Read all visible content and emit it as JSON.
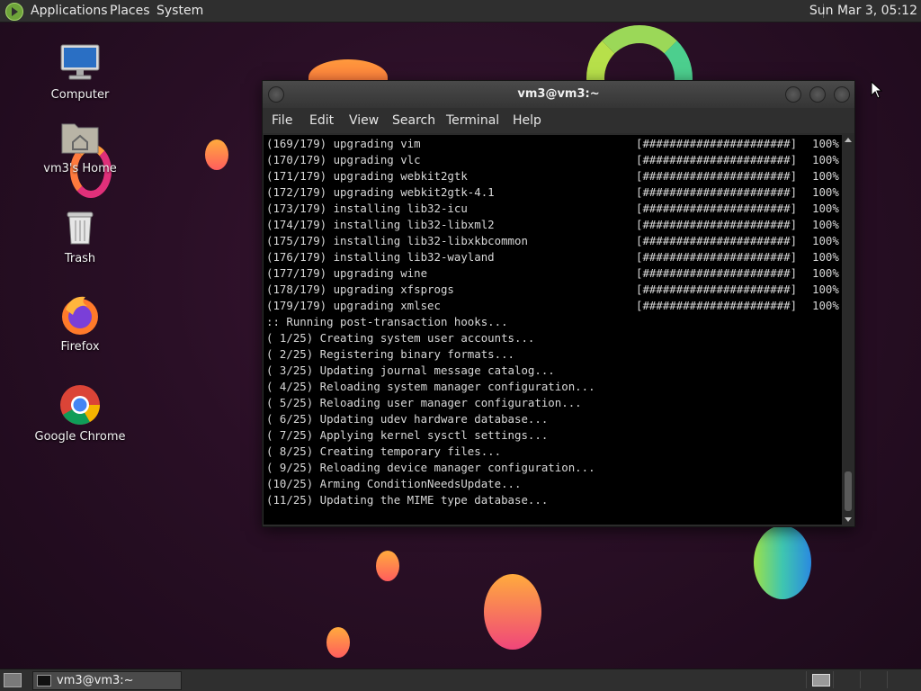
{
  "top_panel": {
    "menus": [
      "Applications",
      "Places",
      "System"
    ],
    "clock": "Sun Mar  3, 05:12"
  },
  "desktop": {
    "icons": [
      {
        "label": "Computer",
        "icon": "computer-icon"
      },
      {
        "label": "vm3's Home",
        "icon": "home-folder-icon"
      },
      {
        "label": "Trash",
        "icon": "trash-icon"
      },
      {
        "label": "Firefox",
        "icon": "firefox-icon"
      },
      {
        "label": "Google Chrome",
        "icon": "chrome-icon"
      }
    ]
  },
  "terminal": {
    "title": "vm3@vm3:~",
    "menu": [
      "File",
      "Edit",
      "View",
      "Search",
      "Terminal",
      "Help"
    ],
    "progress_lines": [
      {
        "text": "(169/179) upgrading vim",
        "bar": "[######################]",
        "pct": "100%"
      },
      {
        "text": "(170/179) upgrading vlc",
        "bar": "[######################]",
        "pct": "100%"
      },
      {
        "text": "(171/179) upgrading webkit2gtk",
        "bar": "[######################]",
        "pct": "100%"
      },
      {
        "text": "(172/179) upgrading webkit2gtk-4.1",
        "bar": "[######################]",
        "pct": "100%"
      },
      {
        "text": "(173/179) installing lib32-icu",
        "bar": "[######################]",
        "pct": "100%"
      },
      {
        "text": "(174/179) installing lib32-libxml2",
        "bar": "[######################]",
        "pct": "100%"
      },
      {
        "text": "(175/179) installing lib32-libxkbcommon",
        "bar": "[######################]",
        "pct": "100%"
      },
      {
        "text": "(176/179) installing lib32-wayland",
        "bar": "[######################]",
        "pct": "100%"
      },
      {
        "text": "(177/179) upgrading wine",
        "bar": "[######################]",
        "pct": "100%"
      },
      {
        "text": "(178/179) upgrading xfsprogs",
        "bar": "[######################]",
        "pct": "100%"
      },
      {
        "text": "(179/179) upgrading xmlsec",
        "bar": "[######################]",
        "pct": "100%"
      }
    ],
    "hook_lines": [
      ":: Running post-transaction hooks...",
      "( 1/25) Creating system user accounts...",
      "( 2/25) Registering binary formats...",
      "( 3/25) Updating journal message catalog...",
      "( 4/25) Reloading system manager configuration...",
      "( 5/25) Reloading user manager configuration...",
      "( 6/25) Updating udev hardware database...",
      "( 7/25) Applying kernel sysctl settings...",
      "( 8/25) Creating temporary files...",
      "( 9/25) Reloading device manager configuration...",
      "(10/25) Arming ConditionNeedsUpdate...",
      "(11/25) Updating the MIME type database..."
    ]
  },
  "taskbar": {
    "task_label": "vm3@vm3:~"
  }
}
